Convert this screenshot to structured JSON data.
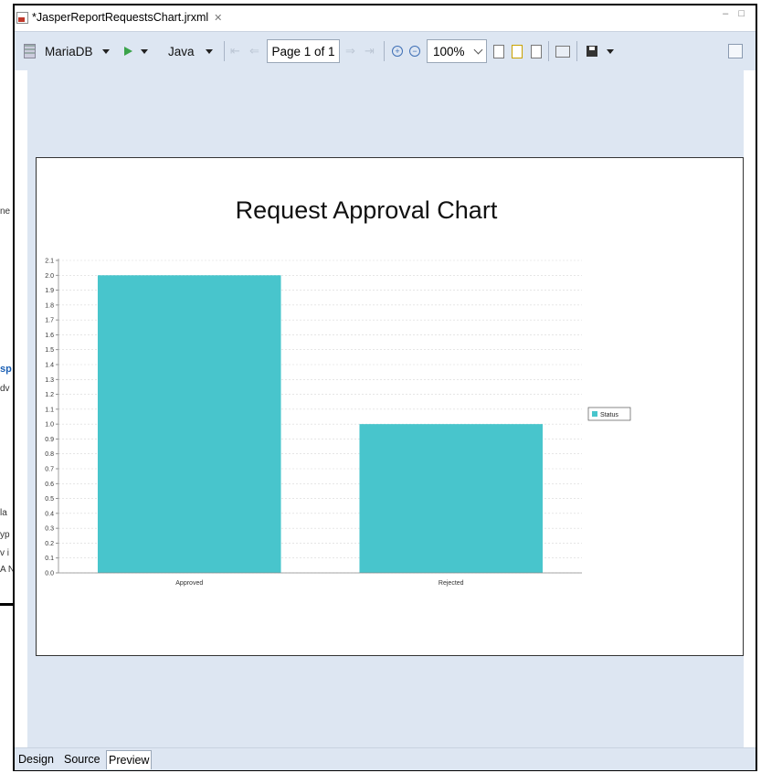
{
  "editor": {
    "tab_title": "*JasperReportRequestsChart.jrxml",
    "close_glyph": "✕",
    "window_controls": "– □"
  },
  "toolbar": {
    "datasource": "MariaDB",
    "language": "Java",
    "page_indicator": "Page 1 of 1",
    "zoom": "100%"
  },
  "bottom_tabs": [
    "Design",
    "Source",
    "Preview"
  ],
  "background_fragments": [
    "ne",
    "sp",
    "dv",
    "la",
    "yp",
    "v i",
    "A N"
  ],
  "colors": {
    "bar": "#48c5cc",
    "toolbar_bg": "#dde6f2"
  },
  "chart_data": {
    "type": "bar",
    "title": "Request Approval Chart",
    "categories": [
      "Approved",
      "Rejected"
    ],
    "series": [
      {
        "name": "Status",
        "values": [
          2.0,
          1.0
        ]
      }
    ],
    "ylim": [
      0,
      2.1
    ],
    "ytick_step": 0.1,
    "yticks": [
      "0.0",
      "0.1",
      "0.2",
      "0.3",
      "0.4",
      "0.5",
      "0.6",
      "0.7",
      "0.8",
      "0.9",
      "1.0",
      "1.1",
      "1.2",
      "1.3",
      "1.4",
      "1.5",
      "1.6",
      "1.7",
      "1.8",
      "1.9",
      "2.0",
      "2.1"
    ],
    "xlabel": "",
    "ylabel": "",
    "grid": true,
    "legend_position": "right"
  }
}
